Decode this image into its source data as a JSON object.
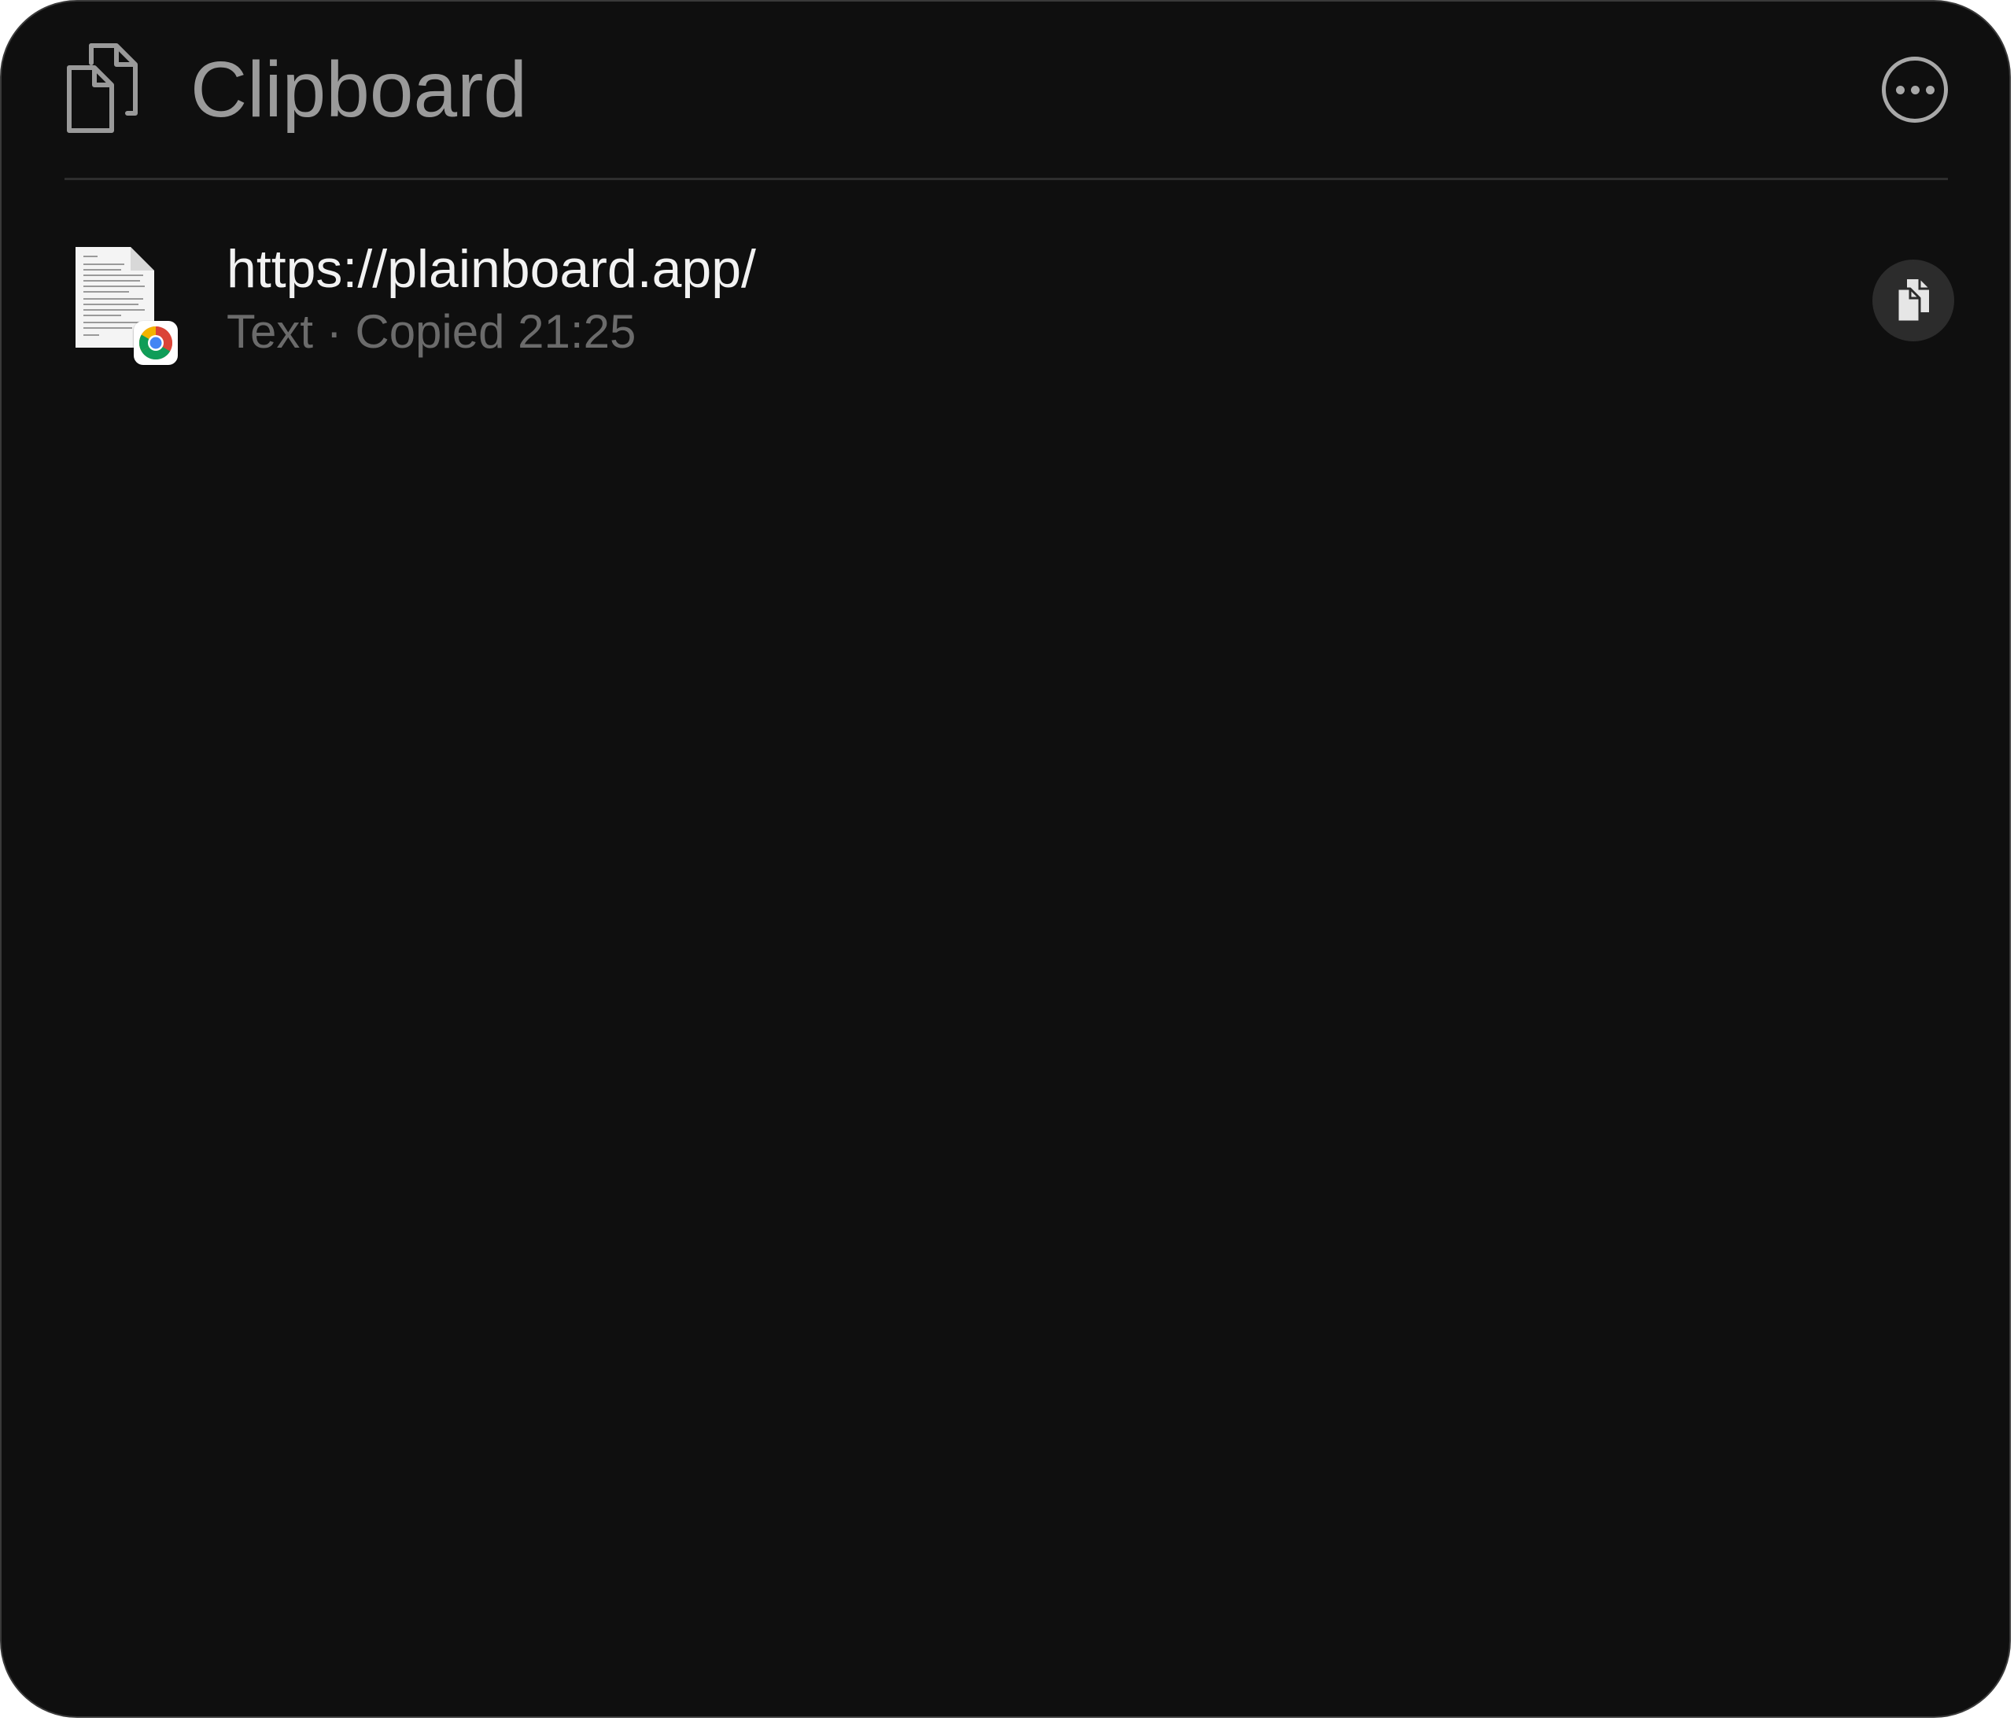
{
  "header": {
    "title": "Clipboard",
    "icon": "documents-icon",
    "more_icon": "ellipsis-circle-icon"
  },
  "entries": [
    {
      "title": "https://plainboard.app/",
      "meta": "Text · Copied 21:25",
      "thumbnail_icon": "text-document-icon",
      "source_app_icon": "chrome-icon",
      "action_icon": "copy-icon"
    }
  ],
  "colors": {
    "background": "#0f0f0f",
    "title_text": "#9a9a9a",
    "entry_title": "#f2f2f2",
    "entry_meta": "#6b6b6b",
    "divider": "#2e2e2e",
    "button_bg": "#2c2c2c"
  }
}
